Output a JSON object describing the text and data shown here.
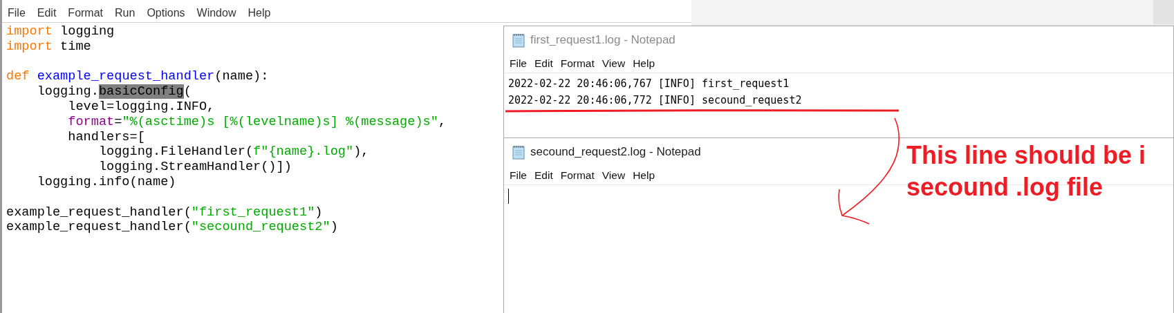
{
  "editor": {
    "menu": [
      "File",
      "Edit",
      "Format",
      "Run",
      "Options",
      "Window",
      "Help"
    ],
    "lines": [
      {
        "kind": "code",
        "tokens": [
          {
            "t": "import",
            "kind": "keyword"
          },
          {
            "t": " logging",
            "kind": "plain"
          }
        ]
      },
      {
        "kind": "code",
        "tokens": [
          {
            "t": "import",
            "kind": "keyword"
          },
          {
            "t": " time",
            "kind": "plain"
          }
        ]
      },
      {
        "kind": "blank"
      },
      {
        "kind": "code",
        "tokens": [
          {
            "t": "def",
            "kind": "keyword"
          },
          {
            "t": " example_request_handler",
            "kind": "definition"
          },
          {
            "t": "(name):",
            "kind": "plain"
          }
        ]
      },
      {
        "kind": "code",
        "tokens": [
          {
            "t": "    logging.",
            "kind": "plain"
          },
          {
            "t": "basicConfig",
            "kind": "selection"
          },
          {
            "t": "(",
            "kind": "plain"
          }
        ]
      },
      {
        "kind": "code",
        "tokens": [
          {
            "t": "        level=logging.INFO,",
            "kind": "plain"
          }
        ]
      },
      {
        "kind": "code",
        "tokens": [
          {
            "t": "        format",
            "kind": "builtin"
          },
          {
            "t": "=",
            "kind": "plain"
          },
          {
            "t": "\"%(asctime)s [%(levelname)s] %(message)s\"",
            "kind": "string"
          },
          {
            "t": ",",
            "kind": "plain"
          }
        ]
      },
      {
        "kind": "code",
        "tokens": [
          {
            "t": "        handlers=[",
            "kind": "plain"
          }
        ]
      },
      {
        "kind": "code",
        "tokens": [
          {
            "t": "            logging.FileHandler(",
            "kind": "plain"
          },
          {
            "t": "f\"{name}.log\"",
            "kind": "string"
          },
          {
            "t": "),",
            "kind": "plain"
          }
        ]
      },
      {
        "kind": "code",
        "tokens": [
          {
            "t": "            logging.StreamHandler()])",
            "kind": "plain"
          }
        ]
      },
      {
        "kind": "code",
        "tokens": [
          {
            "t": "    logging.info(name)",
            "kind": "plain"
          }
        ]
      },
      {
        "kind": "blank"
      },
      {
        "kind": "code",
        "tokens": [
          {
            "t": "example_request_handler(",
            "kind": "plain"
          },
          {
            "t": "\"first_request1\"",
            "kind": "string"
          },
          {
            "t": ")",
            "kind": "plain"
          }
        ]
      },
      {
        "kind": "code",
        "tokens": [
          {
            "t": "example_request_handler(",
            "kind": "plain"
          },
          {
            "t": "\"secound_request2\"",
            "kind": "string"
          },
          {
            "t": ")",
            "kind": "plain"
          }
        ]
      }
    ]
  },
  "notepads": [
    {
      "title": "first_request1.log - Notepad",
      "menu": [
        "File",
        "Edit",
        "Format",
        "View",
        "Help"
      ],
      "lines": [
        "2022-02-22 20:46:06,767 [INFO] first_request1",
        "2022-02-22 20:46:06,772 [INFO] secound_request2"
      ],
      "caret": false
    },
    {
      "title": "secound_request2.log - Notepad",
      "menu": [
        "File",
        "Edit",
        "Format",
        "View",
        "Help"
      ],
      "caret": true
    }
  ],
  "annotation": {
    "note": "This line should be i\nsecound .log file"
  }
}
